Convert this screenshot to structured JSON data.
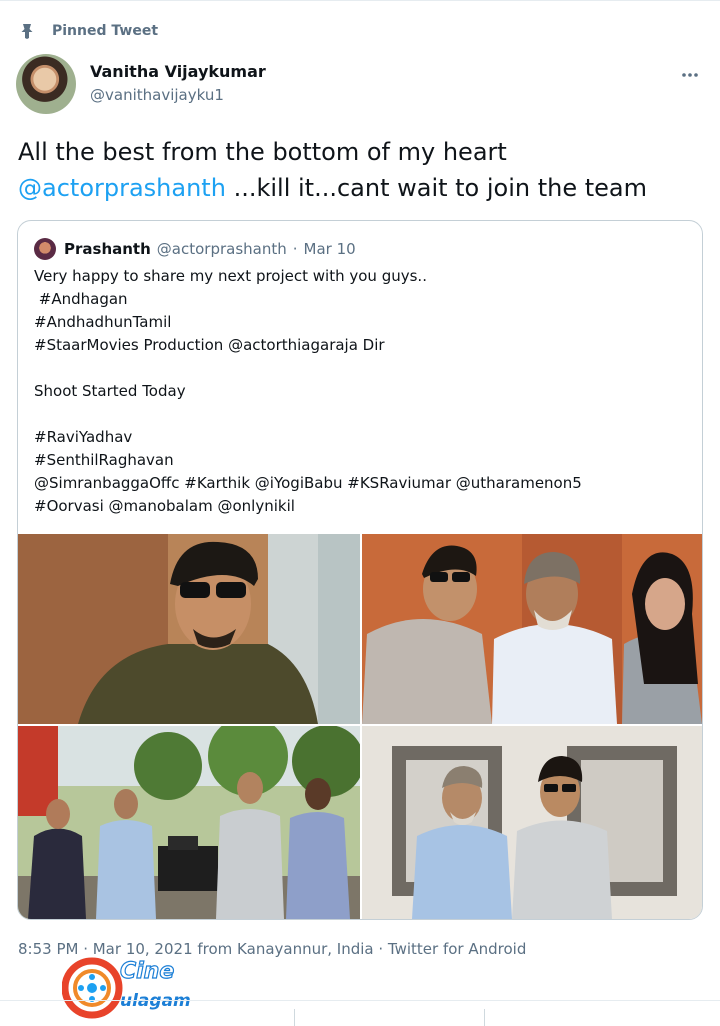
{
  "pinned_label": "Pinned Tweet",
  "author": {
    "name": "Vanitha Vijaykumar",
    "handle": "@vanithavijayku1"
  },
  "tweet": {
    "line1": "All the best from the bottom of my heart",
    "mention": "@actorprashanth",
    "line2_rest": " ...kill it...cant wait to join the team"
  },
  "quoted": {
    "name": "Prashanth",
    "handle": "@actorprashanth",
    "separator": "·",
    "date": "Mar 10",
    "lines": [
      "Very happy to share my next project with you guys..",
      " #Andhagan",
      "#AndhadhunTamil",
      "#StaarMovies Production @actorthiagaraja Dir",
      "",
      "Shoot Started Today",
      "",
      "#RaviYadhav",
      "#SenthilRaghavan",
      "@SimranbaggaOffc #Karthik @iYogiBabu #KSRaviumar @utharamenon5",
      "#Oorvasi @manobalam @onlynikil"
    ]
  },
  "meta_line": "8:53 PM · Mar 10, 2021 from Kanayannur, India · Twitter for Android",
  "watermark": {
    "word1": "Cine",
    "word2": "ulagam"
  },
  "icons": {
    "pin": "pin-icon",
    "more": "more-dots-icon"
  },
  "colors": {
    "accent": "#1da1f2",
    "secondary_text": "#5b7083",
    "border": "#c4cfd6"
  }
}
